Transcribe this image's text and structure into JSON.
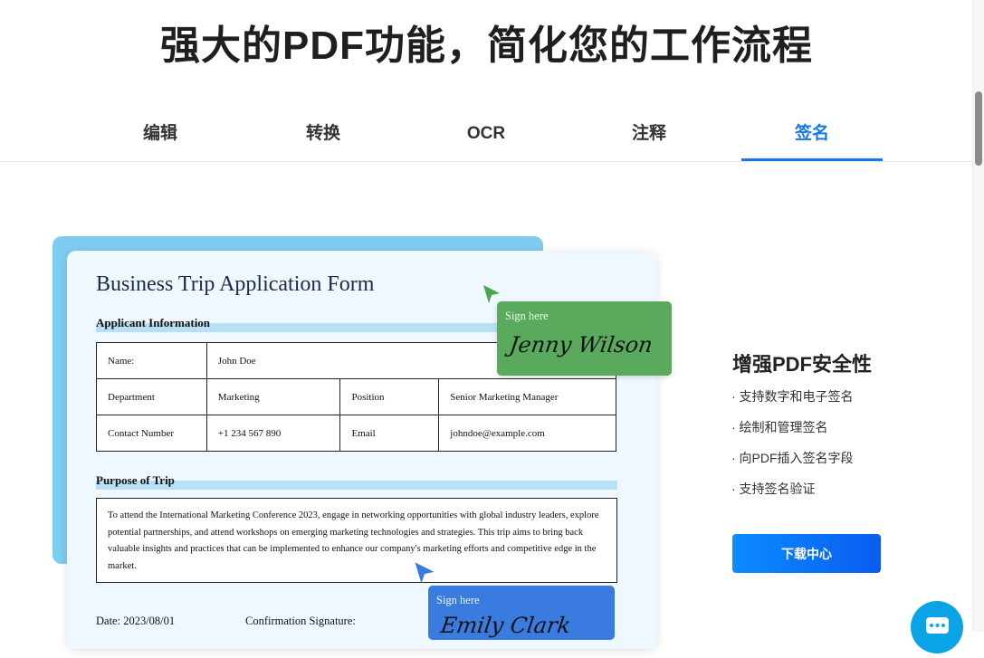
{
  "page": {
    "title": "强大的PDF功能，简化您的工作流程"
  },
  "tabs": [
    {
      "label": "编辑"
    },
    {
      "label": "转换"
    },
    {
      "label": "OCR"
    },
    {
      "label": "注释"
    },
    {
      "label": "签名",
      "active": true
    }
  ],
  "form": {
    "title": "Business Trip Application Form",
    "applicant_section": "Applicant Information",
    "fields": {
      "name_label": "Name:",
      "name_value": "John Doe",
      "department_label": "Department",
      "department_value": "Marketing",
      "position_label": "Position",
      "position_value": "Senior Marketing Manager",
      "contact_label": "Contact Number",
      "contact_value": "+1 234 567 890",
      "email_label": "Email",
      "email_value": "johndoe@example.com"
    },
    "purpose_section": "Purpose of Trip",
    "purpose_text": "To attend the International Marketing Conference 2023, engage in networking opportunities with global industry leaders, explore potential partnerships, and attend workshops on emerging marketing technologies and strategies. This trip aims to bring back valuable insights and practices that can be implemented to enhance our company's marketing efforts and competitive edge in the market.",
    "date_line": "Date: 2023/08/01",
    "confirmation_label": "Confirmation Signature:"
  },
  "signatures": {
    "green": {
      "label": "Sign here",
      "signature": "Jenny Wilson"
    },
    "blue": {
      "label": "Sign here",
      "signature": "Emily Clark"
    }
  },
  "features": {
    "title": "增强PDF安全性",
    "items": [
      "· 支持数字和电子签名",
      "· 绘制和管理签名",
      "· 向PDF插入签名字段",
      "· 支持签名验证"
    ],
    "download_label": "下载中心"
  },
  "colors": {
    "accent": "#1677e6",
    "green_signature": "#5aaa5e",
    "blue_signature": "#3a7be0",
    "card_backdrop": "#7dcdf0"
  }
}
